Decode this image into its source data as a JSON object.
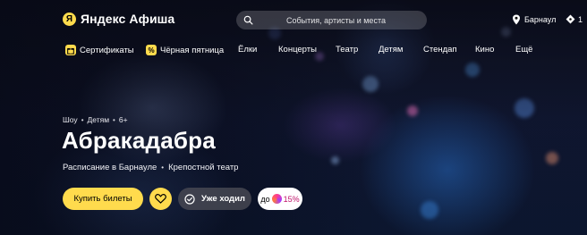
{
  "header": {
    "logo_mark": "Я",
    "logo_text": "Яндекс Афиша",
    "search_placeholder": "События, артисты и места",
    "city": "Барнаул",
    "tickets_count": "1"
  },
  "nav": {
    "items": [
      {
        "label": "Сертификаты",
        "icon": "gift-icon"
      },
      {
        "label": "Чёрная пятница",
        "icon": "percent-icon"
      },
      {
        "label": "Ёлки"
      },
      {
        "label": "Концерты"
      },
      {
        "label": "Театр"
      },
      {
        "label": "Детям"
      },
      {
        "label": "Стендап"
      },
      {
        "label": "Кино"
      },
      {
        "label": "Ещё"
      }
    ]
  },
  "event": {
    "tags": [
      "Шоу",
      "Детям",
      "6+"
    ],
    "title": "Абракадабра",
    "schedule_link": "Расписание в Барнауле",
    "venue": "Крепостной театр"
  },
  "actions": {
    "buy_label": "Купить билеты",
    "seen_label": "Уже ходил",
    "plus_prefix": "до",
    "plus_percent": "15%"
  },
  "colors": {
    "accent": "#ffdb4d",
    "background": "#0f1630",
    "plus_pink": "#c0146b"
  }
}
